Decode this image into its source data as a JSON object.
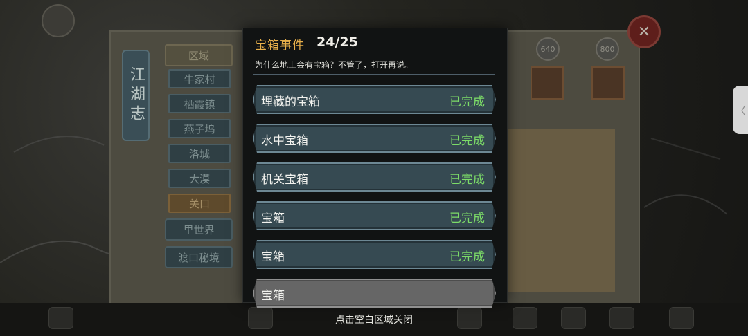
{
  "modal": {
    "title": "宝箱事件",
    "progress": "24/25",
    "description": "为什么地上会有宝箱？不管了，打开再说。",
    "events": [
      {
        "name": "埋藏的宝箱",
        "status": "已完成",
        "locked": false
      },
      {
        "name": "水中宝箱",
        "status": "已完成",
        "locked": false
      },
      {
        "name": "机关宝箱",
        "status": "已完成",
        "locked": false
      },
      {
        "name": "宝箱",
        "status": "已完成",
        "locked": false
      },
      {
        "name": "宝箱",
        "status": "已完成",
        "locked": false
      },
      {
        "name": "宝箱",
        "status": "",
        "locked": true
      }
    ]
  },
  "background": {
    "banner": "江湖志",
    "region_label": "区域",
    "regions": [
      "牛家村",
      "栖霞镇",
      "燕子坞",
      "洛城",
      "大漠",
      "关口"
    ],
    "extra_buttons": [
      "里世界",
      "渡口秘境"
    ],
    "score_chips": [
      "640",
      "800"
    ]
  },
  "hint": "点击空白区域关闭",
  "colors": {
    "title_gold": "#e8b04a",
    "completed_green": "#7cdc68",
    "row_bg": "#364a52",
    "locked_row_bg": "#666666"
  },
  "icons": {
    "close": "close-x-icon",
    "side_handle": "chevron-left-icon"
  }
}
